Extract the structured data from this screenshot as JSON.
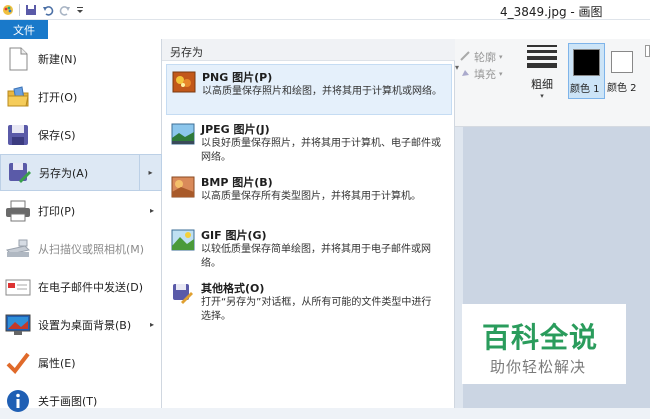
{
  "window": {
    "title": "4_3849.jpg - 画图"
  },
  "file_tab": {
    "label": "文件"
  },
  "ribbon": {
    "outline_label": "轮廓",
    "fill_label": "填充",
    "size_label": "粗细",
    "color1_label": "颜色 1",
    "color2_label": "颜色 2"
  },
  "menu": {
    "items": [
      {
        "label": "新建(N)",
        "icon": "new-file-icon"
      },
      {
        "label": "打开(O)",
        "icon": "open-folder-icon"
      },
      {
        "label": "保存(S)",
        "icon": "save-disk-icon"
      },
      {
        "label": "另存为(A)",
        "icon": "save-as-icon"
      },
      {
        "label": "打印(P)",
        "icon": "printer-icon"
      },
      {
        "label": "从扫描仪或照相机(M)",
        "icon": "scanner-icon"
      },
      {
        "label": "在电子邮件中发送(D)",
        "icon": "email-icon"
      },
      {
        "label": "设置为桌面背景(B)",
        "icon": "desktop-icon"
      },
      {
        "label": "属性(E)",
        "icon": "checkmark-icon"
      },
      {
        "label": "关于画图(T)",
        "icon": "info-icon"
      }
    ]
  },
  "save_as": {
    "header": "另存为",
    "items": [
      {
        "title": "PNG 图片(P)",
        "desc": "以高质量保存照片和绘图，并将其用于计算机或网络。",
        "icon": "png-image-icon"
      },
      {
        "title": "JPEG 图片(J)",
        "desc": "以良好质量保存照片，并将其用于计算机、电子邮件或网络。",
        "icon": "jpeg-image-icon"
      },
      {
        "title": "BMP 图片(B)",
        "desc": "以高质量保存所有类型图片，并将其用于计算机。",
        "icon": "bmp-image-icon"
      },
      {
        "title": "GIF 图片(G)",
        "desc": "以较低质量保存简单绘图，并将其用于电子邮件或网络。",
        "icon": "gif-image-icon"
      },
      {
        "title": "其他格式(O)",
        "desc": "打开“另存为”对话框，从所有可能的文件类型中进行选择。",
        "icon": "other-formats-icon"
      }
    ]
  },
  "watermark": {
    "title": "百科全说",
    "subtitle": "助你轻松解决"
  },
  "colors": {
    "accent": "#1979ca",
    "selected_bg": "#dde8f4",
    "hover_bg": "#e5f0fb",
    "brand_green": "#2a9c5c"
  }
}
